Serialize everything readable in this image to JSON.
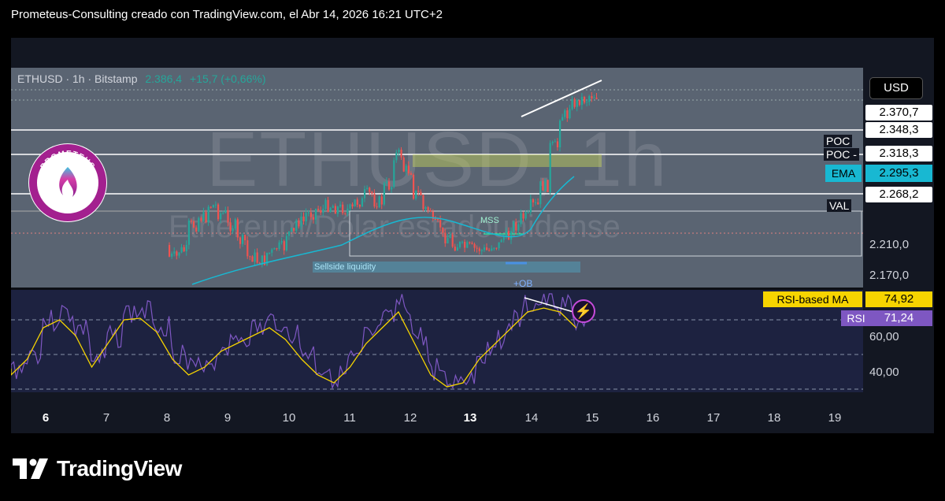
{
  "header": {
    "title": "Prometeus-Consulting creado con TradingView.com, el Abr 14, 2026 16:21 UTC+2"
  },
  "symbol": {
    "name": "ETHUSD · 1h · Bitstamp",
    "price": "2.386,4",
    "change": "+15,7 (+0,66%)"
  },
  "watermark": {
    "symbol": "ETHUSD, 1h",
    "description": "Ethereum/Dólar estadounidense"
  },
  "logo": {
    "top_text": "PROMETEUS",
    "bottom_text": "Consulting"
  },
  "currency_button": {
    "label": "USD"
  },
  "price_axis": {
    "labels": [
      "2.370,7",
      "2.348,3",
      "2.318,3",
      "2.295,3",
      "2.268,2",
      "2.210,0",
      "2.170,0"
    ],
    "tags": {
      "poc1": "POC",
      "poc2": "POC -",
      "ema": "EMA",
      "val": "VAL"
    }
  },
  "annotations": {
    "sellside": "Sellside liquidity",
    "mss": "MSS",
    "ob": "+OB"
  },
  "rsi": {
    "ma_label": "RSI-based MA",
    "ma_value": "74,92",
    "rsi_label": "RSI",
    "rsi_value": "71,24",
    "levels": [
      "60,00",
      "40,00"
    ]
  },
  "time_axis": {
    "ticks": [
      "6",
      "7",
      "8",
      "9",
      "10",
      "11",
      "12",
      "13",
      "14",
      "15",
      "16",
      "17",
      "18",
      "19"
    ],
    "bold": [
      "6",
      "13"
    ]
  },
  "footer": {
    "brand": "TradingView"
  },
  "colors": {
    "up": "#26a69a",
    "down": "#ef5350",
    "ema": "#18b8d2",
    "rsi": "#7e57c2",
    "rsi_ma": "#f6d400",
    "background": "#131722"
  }
}
